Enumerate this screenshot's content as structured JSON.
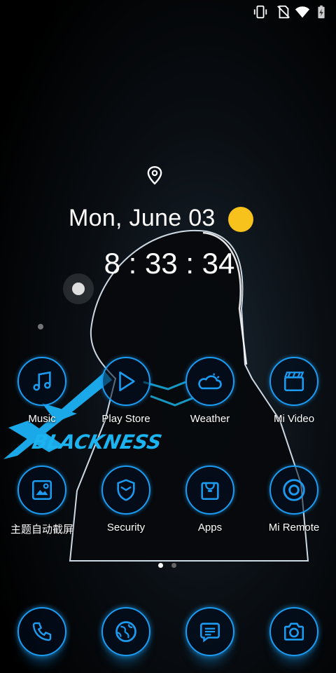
{
  "status_bar": {
    "icons": [
      "vibrate-icon",
      "no-sim-icon",
      "wifi-icon",
      "battery-charging-icon"
    ]
  },
  "clock_widget": {
    "location_icon": "location-pin-icon",
    "date": "Mon, June 03",
    "weather_icon": "sun-icon",
    "time": "8 : 33 : 34"
  },
  "wallpaper": {
    "logo_text": "XBLACKNESS"
  },
  "home_grid": [
    {
      "label": "Music",
      "icon": "music-note-icon"
    },
    {
      "label": "Play Store",
      "icon": "play-store-icon"
    },
    {
      "label": "Weather",
      "icon": "weather-cloud-icon"
    },
    {
      "label": "Mi Video",
      "icon": "clapperboard-icon"
    },
    {
      "label": "主题自动截屏",
      "icon": "screenshot-icon"
    },
    {
      "label": "Security",
      "icon": "shield-icon"
    },
    {
      "label": "Apps",
      "icon": "shopping-bag-icon"
    },
    {
      "label": "Mi Remote",
      "icon": "remote-icon"
    }
  ],
  "page_indicator": {
    "total": 2,
    "active": 1
  },
  "dock": [
    {
      "icon": "phone-icon"
    },
    {
      "icon": "browser-globe-icon"
    },
    {
      "icon": "messages-icon"
    },
    {
      "icon": "camera-icon"
    }
  ],
  "colors": {
    "accent": "#1b9cf2",
    "sun": "#f7c21b",
    "background": "#000000"
  }
}
